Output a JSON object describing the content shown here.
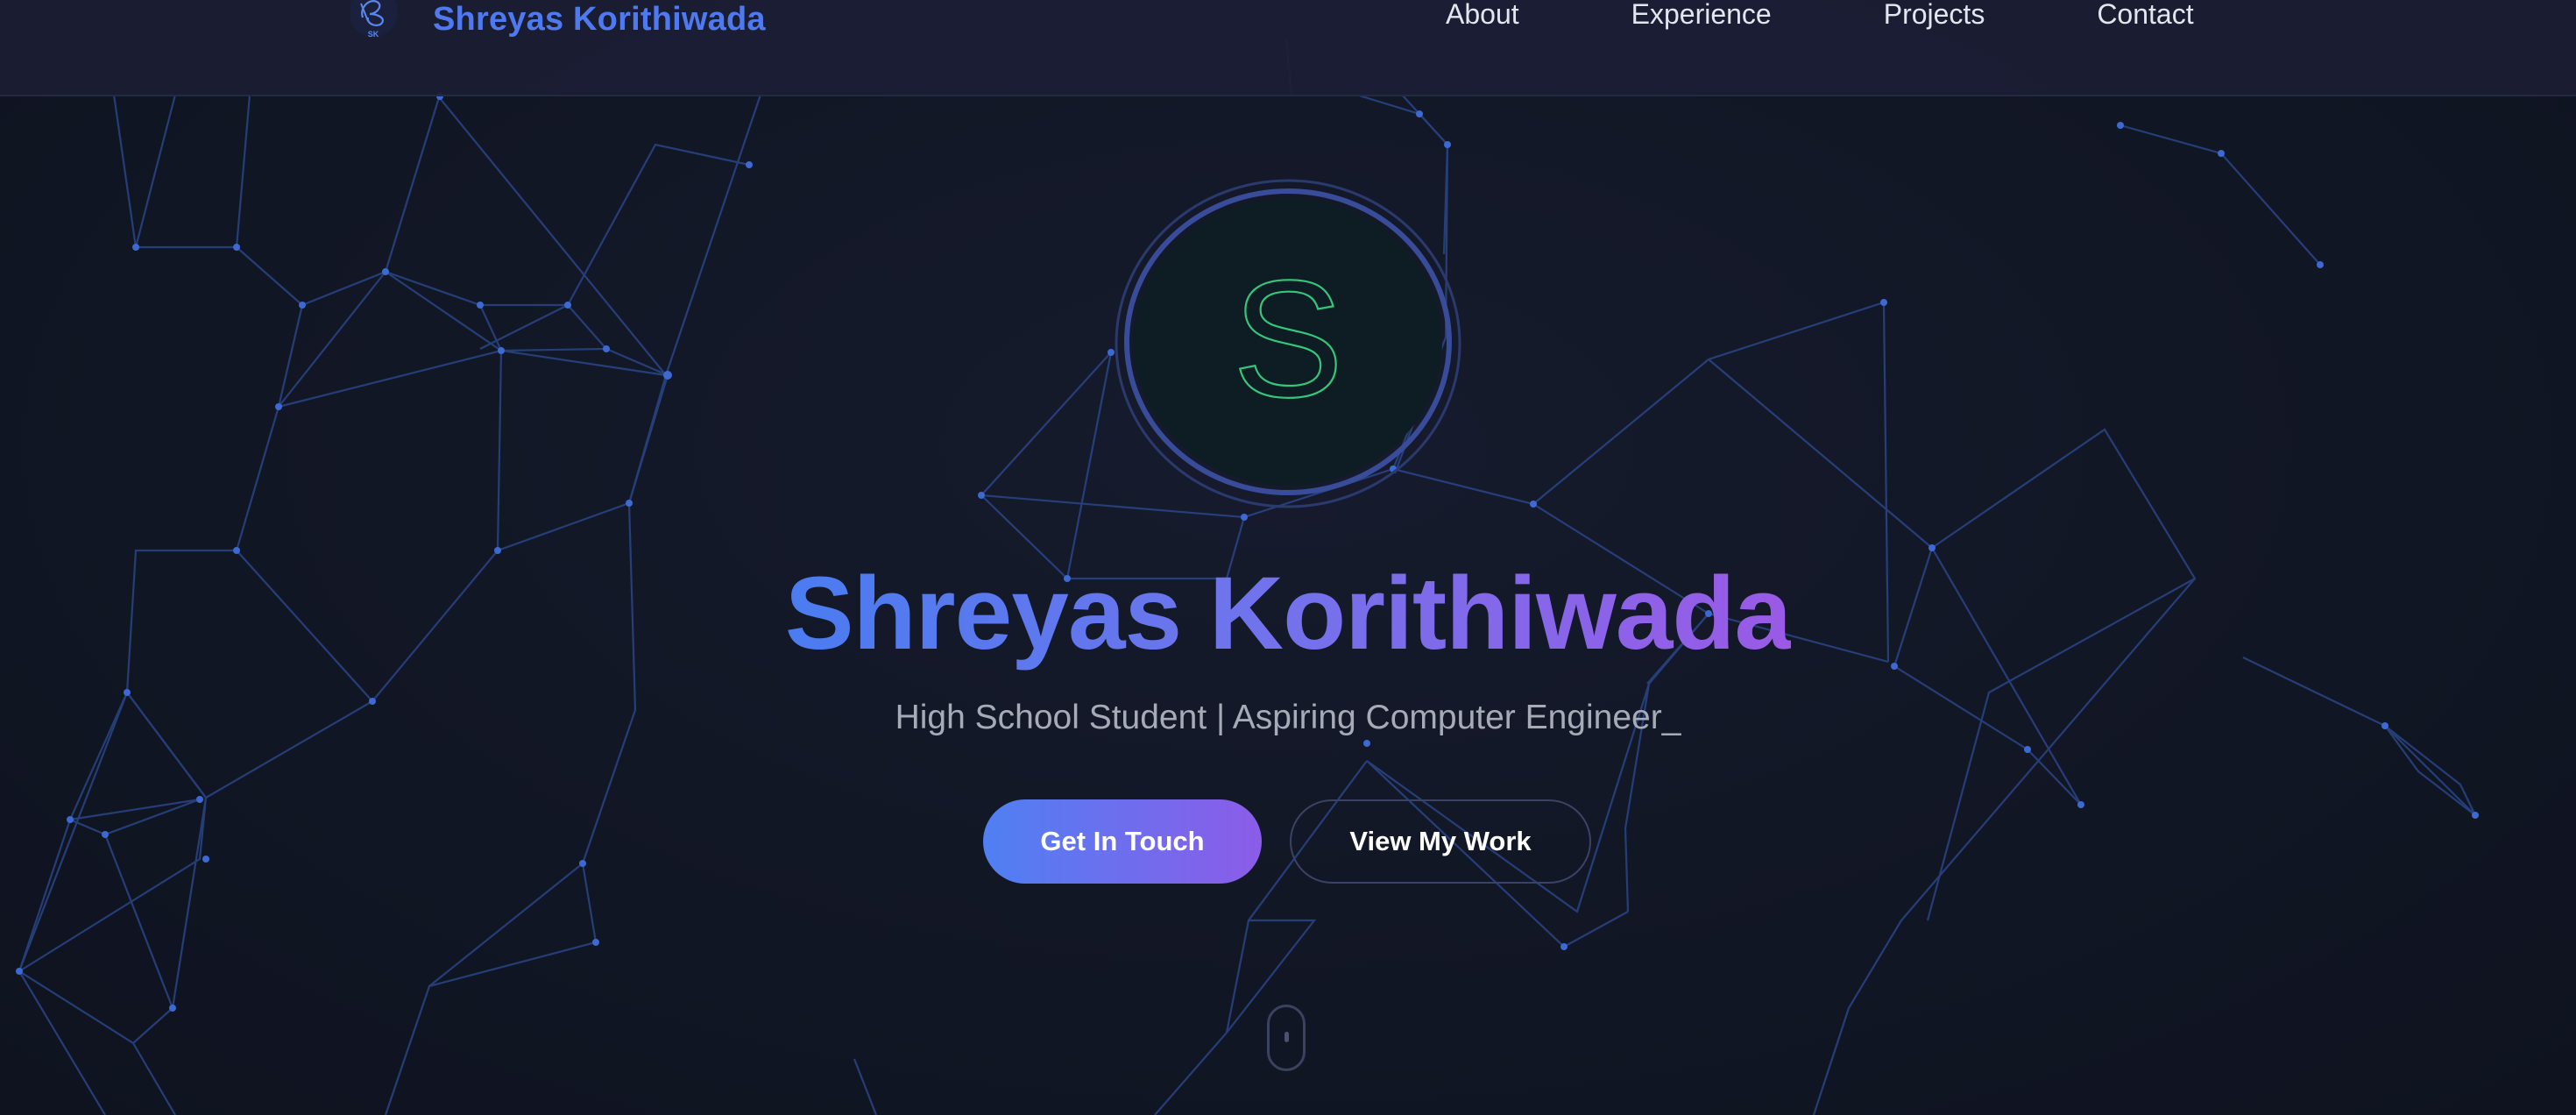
{
  "brand": {
    "name": "Shreyas Korithiwada",
    "logo_initials": "SK",
    "logo_icon": "signature-logo-icon"
  },
  "nav": {
    "items": [
      {
        "label": "About"
      },
      {
        "label": "Experience"
      },
      {
        "label": "Projects"
      },
      {
        "label": "Contact"
      }
    ]
  },
  "hero": {
    "avatar_letter": "S",
    "name": "Shreyas Korithiwada",
    "subtitle": "High School Student | Aspiring Computer Engineer_",
    "primary_button": "Get In Touch",
    "secondary_button": "View My Work",
    "scroll_icon": "mouse-scroll-icon"
  },
  "colors": {
    "background": "#111624",
    "accent_blue": "#4f80f3",
    "accent_purple": "#9a5ae6",
    "avatar_letter": "#34c77b",
    "network_line": "#2f4f9a"
  }
}
